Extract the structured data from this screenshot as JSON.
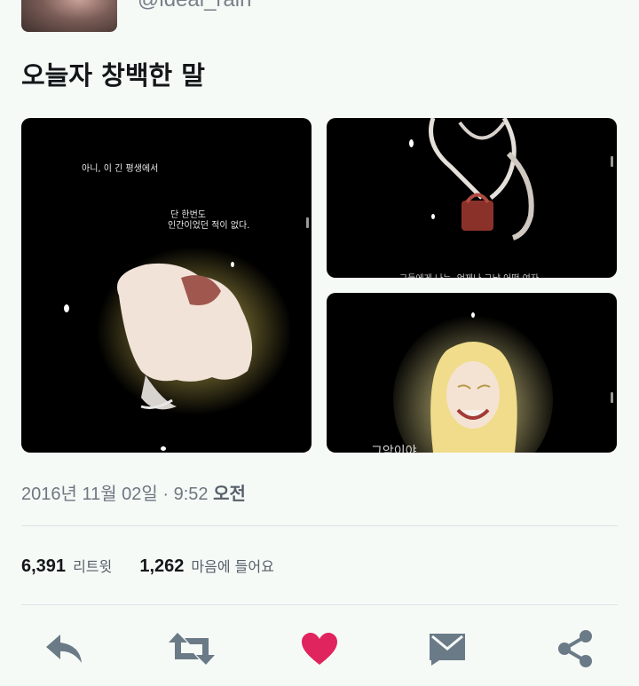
{
  "user": {
    "handle": "@ideal_rain"
  },
  "tweet": {
    "text": "오늘자 창백한 말"
  },
  "media": {
    "img1_caption_line1": "아니, 이 긴 평생에서",
    "img1_caption_line2": "단 한번도",
    "img1_caption_line3": "인간이었던 적이 없다.",
    "img2_caption": "그들에게 나는, 언제나 그냥 어떤 여자",
    "img3_caption": "그악이야"
  },
  "meta": {
    "date": "2016년 11월 02일",
    "separator": "·",
    "time": "9:52",
    "ampm": "오전"
  },
  "stats": {
    "retweets": {
      "count": "6,391",
      "label": "리트윗"
    },
    "likes": {
      "count": "1,262",
      "label": "마음에 들어요"
    }
  },
  "actions": {
    "reply_icon": "reply-icon",
    "retweet_icon": "retweet-icon",
    "like_icon": "heart-icon",
    "dm_icon": "envelope-icon",
    "share_icon": "share-icon"
  },
  "colors": {
    "background": "#f6faf7",
    "icon_gray": "#6b7a87",
    "like_red": "#e0245e",
    "text_primary": "#14171a",
    "text_secondary": "#6e7780"
  }
}
